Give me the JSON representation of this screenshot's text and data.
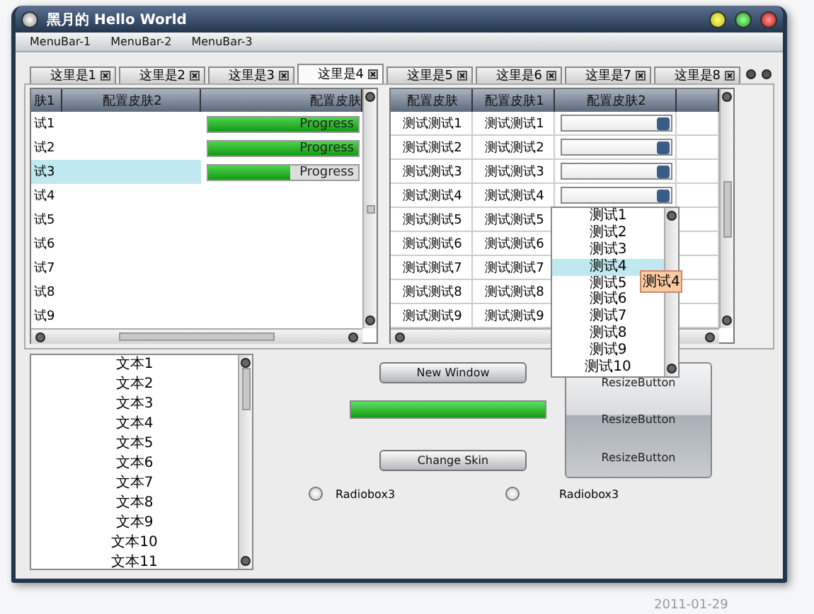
{
  "window": {
    "title": "黑月的 Hello World"
  },
  "menu_bar": [
    "MenuBar-1",
    "MenuBar-2",
    "MenuBar-3"
  ],
  "tabs": [
    {
      "label": "这里是1",
      "selected": false
    },
    {
      "label": "这里是2",
      "selected": false
    },
    {
      "label": "这里是3",
      "selected": false
    },
    {
      "label": "这里是4",
      "selected": true
    },
    {
      "label": "这里是5",
      "selected": false
    },
    {
      "label": "这里是6",
      "selected": false
    },
    {
      "label": "这里是7",
      "selected": false
    },
    {
      "label": "这里是8",
      "selected": false
    }
  ],
  "left_table": {
    "columns": [
      "肤1",
      "配置皮肤2",
      "配置皮肤"
    ],
    "rows": [
      {
        "name": "试1",
        "selected": false,
        "progress": {
          "text": "Progress",
          "level": 1
        }
      },
      {
        "name": "试2",
        "selected": false,
        "progress": {
          "text": "Progress",
          "level": 1
        }
      },
      {
        "name": "试3",
        "selected": true,
        "progress": {
          "text": "Progress",
          "level": 0.55
        }
      },
      {
        "name": "试4",
        "selected": false
      },
      {
        "name": "试5",
        "selected": false
      },
      {
        "name": "试6",
        "selected": false
      },
      {
        "name": "试7",
        "selected": false
      },
      {
        "name": "试8",
        "selected": false
      },
      {
        "name": "试9",
        "selected": false
      }
    ]
  },
  "right_table": {
    "columns": [
      "配置皮肤",
      "配置皮肤1",
      "配置皮肤2"
    ],
    "rows": [
      {
        "cells": [
          "测试测试1",
          "测试测试1"
        ],
        "kind": "combo"
      },
      {
        "cells": [
          "测试测试2",
          "测试测试2"
        ],
        "kind": "combo"
      },
      {
        "cells": [
          "测试测试3",
          "测试测试3"
        ],
        "kind": "combo"
      },
      {
        "cells": [
          "测试测试4",
          "测试测试4"
        ],
        "kind": "combo"
      },
      {
        "cells": [
          "测试测试5",
          "测试测试5"
        ],
        "kind": "text"
      },
      {
        "cells": [
          "测试测试6",
          "测试测试6"
        ],
        "kind": "text"
      },
      {
        "cells": [
          "测试测试7",
          "测试测试7"
        ],
        "kind": "text"
      },
      {
        "cells": [
          "测试测试8",
          "测试测试8"
        ],
        "kind": "text"
      },
      {
        "cells": [
          "测试测试9",
          "测试测试9"
        ],
        "kind": "text"
      }
    ]
  },
  "dropdown": {
    "options": [
      {
        "label": "测试1",
        "selected": false
      },
      {
        "label": "测试2",
        "selected": false
      },
      {
        "label": "测试3",
        "selected": false
      },
      {
        "label": "测试4",
        "selected": true
      },
      {
        "label": "测试5",
        "selected": false
      },
      {
        "label": "测试6",
        "selected": false
      },
      {
        "label": "测试7",
        "selected": false
      },
      {
        "label": "测试8",
        "selected": false
      },
      {
        "label": "测试9",
        "selected": false
      },
      {
        "label": "测试10",
        "selected": false
      }
    ],
    "tooltip": "测试4"
  },
  "list": [
    "文本1",
    "文本2",
    "文本3",
    "文本4",
    "文本5",
    "文本6",
    "文本7",
    "文本8",
    "文本9",
    "文本10",
    "文本11"
  ],
  "actions": [
    {
      "label": "New Window"
    },
    {
      "label": "Change Skin"
    }
  ],
  "progress": {
    "level": 1
  },
  "resize_buttons": [
    "ResizeButton",
    "ResizeButton",
    "ResizeButton"
  ],
  "radios": [
    {
      "label": "Radiobox3",
      "selected": false
    },
    {
      "label": "Radiobox3",
      "selected": false
    }
  ],
  "background": {
    "date": "2011-01-29"
  }
}
